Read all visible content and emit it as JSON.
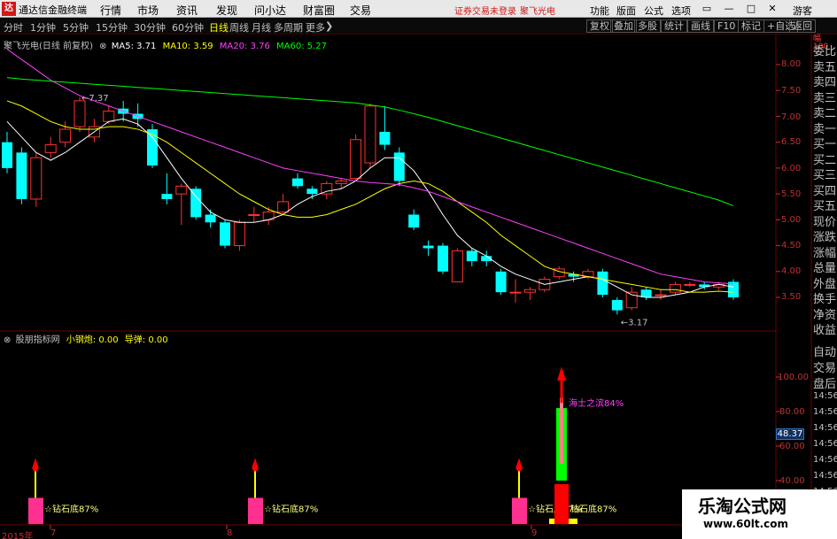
{
  "app": {
    "logo_char": "达",
    "name": "通达信金融终端",
    "menu": [
      "行情",
      "市场",
      "资讯",
      "发现",
      "问小达",
      "财富圈",
      "交易"
    ],
    "status": "证券交易未登录",
    "stock_title": "聚飞光电",
    "right_menu": [
      "功能",
      "版面",
      "公式",
      "选项",
      "游客"
    ],
    "window_controls": [
      "▭",
      "—",
      "□",
      "✕"
    ]
  },
  "toolbar": {
    "periods": [
      "分时",
      "1分钟",
      "5分钟",
      "15分钟",
      "30分钟",
      "60分钟",
      "日线",
      "周线",
      "月线",
      "多周期",
      "更多"
    ],
    "active_period": "日线",
    "more_glyph": "❯",
    "right_buttons": [
      "复权",
      "叠加",
      "多股",
      "统计",
      "画线",
      "F10",
      "标记",
      "+自选",
      "返回"
    ]
  },
  "kline_info": {
    "stock": "聚飞光电(日线 前复权)",
    "ma5": "MA5: 3.71",
    "ma10": "MA10: 3.59",
    "ma20": "MA20: 3.76",
    "ma60": "MA60: 5.27",
    "high_mark": "7.37",
    "low_mark": "3.17"
  },
  "indicator_info": {
    "name": "股朋指标网",
    "v1": "小钢炮: 0.00",
    "v2": "导弹: 0.00",
    "label_diamond": "钻石底87%",
    "label_star": "☆",
    "label_top": "海士之滨84%"
  },
  "right_panel": {
    "top_glyphs": [
      "幅",
      "100"
    ],
    "labels": [
      "委比",
      "卖五",
      "卖四",
      "卖三",
      "卖二",
      "卖一",
      "买一",
      "买二",
      "买三",
      "买四",
      "买五",
      "现价",
      "涨跌",
      "涨幅",
      "总量",
      "外盘",
      "换手",
      "净资",
      "收益"
    ],
    "labels2": [
      "自动",
      "交易",
      "盘后"
    ],
    "times": [
      "14:56",
      "14:56",
      "14:56",
      "14:56",
      "14:56",
      "14:56",
      "14:56",
      "14:56",
      "14:56"
    ]
  },
  "price_axis": [
    "8.00",
    "7.50",
    "7.00",
    "6.50",
    "6.00",
    "5.50",
    "5.00",
    "4.50",
    "4.00",
    "3.50"
  ],
  "ind_axis": [
    "100.00",
    "80.00",
    "60.00",
    "40.00"
  ],
  "ind_current": "48.37",
  "dates": [
    "2015年",
    "7",
    "8",
    "9"
  ],
  "watermark": {
    "title": "乐淘公式网",
    "url": "www.60lt.com"
  },
  "colors": {
    "up": "#ff3030",
    "down": "#00ffff",
    "ma5": "#ffffff",
    "ma10": "#ffff00",
    "ma20": "#ff40ff",
    "ma60": "#00ff00",
    "bar_pink": "#ff3090",
    "bar_yellow": "#ffff00",
    "bar_green": "#00ff00",
    "bar_red": "#ff0000"
  },
  "chart_data": {
    "type": "candlestick",
    "price_range": [
      3.17,
      8.5
    ],
    "candles": [
      {
        "o": 6.5,
        "c": 6.0,
        "h": 6.7,
        "l": 5.9
      },
      {
        "o": 6.3,
        "c": 5.4,
        "h": 6.4,
        "l": 5.3
      },
      {
        "o": 5.4,
        "c": 6.2,
        "h": 6.3,
        "l": 5.25
      },
      {
        "o": 6.3,
        "c": 6.45,
        "h": 6.6,
        "l": 6.2
      },
      {
        "o": 6.5,
        "c": 6.75,
        "h": 6.9,
        "l": 6.4
      },
      {
        "o": 6.8,
        "c": 7.3,
        "h": 7.37,
        "l": 6.7
      },
      {
        "o": 6.6,
        "c": 6.8,
        "h": 6.95,
        "l": 6.5
      },
      {
        "o": 6.9,
        "c": 7.1,
        "h": 7.2,
        "l": 6.85
      },
      {
        "o": 7.15,
        "c": 7.05,
        "h": 7.3,
        "l": 6.9
      },
      {
        "o": 7.05,
        "c": 6.95,
        "h": 7.25,
        "l": 6.8
      },
      {
        "o": 6.75,
        "c": 6.05,
        "h": 6.85,
        "l": 6.0
      },
      {
        "o": 5.5,
        "c": 5.4,
        "h": 5.9,
        "l": 5.3
      },
      {
        "o": 5.5,
        "c": 5.65,
        "h": 5.7,
        "l": 4.9
      },
      {
        "o": 5.6,
        "c": 5.05,
        "h": 5.65,
        "l": 5.0
      },
      {
        "o": 5.1,
        "c": 4.95,
        "h": 5.2,
        "l": 4.85
      },
      {
        "o": 4.95,
        "c": 4.5,
        "h": 5.0,
        "l": 4.45
      },
      {
        "o": 4.5,
        "c": 4.95,
        "h": 5.0,
        "l": 4.4
      },
      {
        "o": 5.1,
        "c": 5.1,
        "h": 5.25,
        "l": 4.95
      },
      {
        "o": 5.0,
        "c": 5.15,
        "h": 5.25,
        "l": 4.9
      },
      {
        "o": 5.15,
        "c": 5.35,
        "h": 5.5,
        "l": 5.1
      },
      {
        "o": 5.8,
        "c": 5.65,
        "h": 5.9,
        "l": 5.6
      },
      {
        "o": 5.6,
        "c": 5.5,
        "h": 5.65,
        "l": 5.4
      },
      {
        "o": 5.5,
        "c": 5.7,
        "h": 5.75,
        "l": 5.4
      },
      {
        "o": 5.7,
        "c": 5.75,
        "h": 5.8,
        "l": 5.6
      },
      {
        "o": 5.8,
        "c": 6.55,
        "h": 6.65,
        "l": 5.75
      },
      {
        "o": 6.1,
        "c": 7.2,
        "h": 7.25,
        "l": 6.0
      },
      {
        "o": 6.7,
        "c": 6.45,
        "h": 7.2,
        "l": 6.35
      },
      {
        "o": 6.3,
        "c": 5.75,
        "h": 6.4,
        "l": 5.65
      },
      {
        "o": 5.1,
        "c": 4.85,
        "h": 5.2,
        "l": 4.8
      },
      {
        "o": 4.5,
        "c": 4.45,
        "h": 4.6,
        "l": 4.3
      },
      {
        "o": 4.5,
        "c": 4.0,
        "h": 4.55,
        "l": 3.95
      },
      {
        "o": 3.8,
        "c": 4.4,
        "h": 4.45,
        "l": 3.8
      },
      {
        "o": 4.4,
        "c": 4.2,
        "h": 4.45,
        "l": 4.1
      },
      {
        "o": 4.3,
        "c": 4.2,
        "h": 4.4,
        "l": 4.1
      },
      {
        "o": 4.0,
        "c": 3.6,
        "h": 4.05,
        "l": 3.55
      },
      {
        "o": 3.6,
        "c": 3.6,
        "h": 3.85,
        "l": 3.4
      },
      {
        "o": 3.6,
        "c": 3.65,
        "h": 3.7,
        "l": 3.45
      },
      {
        "o": 3.65,
        "c": 3.85,
        "h": 3.9,
        "l": 3.6
      },
      {
        "o": 3.9,
        "c": 4.05,
        "h": 4.1,
        "l": 3.85
      },
      {
        "o": 3.95,
        "c": 3.9,
        "h": 4.0,
        "l": 3.8
      },
      {
        "o": 3.9,
        "c": 4.0,
        "h": 4.05,
        "l": 3.85
      },
      {
        "o": 4.0,
        "c": 3.55,
        "h": 4.05,
        "l": 3.5
      },
      {
        "o": 3.45,
        "c": 3.25,
        "h": 3.5,
        "l": 3.17
      },
      {
        "o": 3.3,
        "c": 3.6,
        "h": 3.7,
        "l": 3.25
      },
      {
        "o": 3.65,
        "c": 3.5,
        "h": 3.7,
        "l": 3.45
      },
      {
        "o": 3.55,
        "c": 3.55,
        "h": 3.65,
        "l": 3.45
      },
      {
        "o": 3.6,
        "c": 3.75,
        "h": 3.8,
        "l": 3.55
      },
      {
        "o": 3.75,
        "c": 3.75,
        "h": 3.8,
        "l": 3.7
      },
      {
        "o": 3.75,
        "c": 3.7,
        "h": 3.8,
        "l": 3.65
      },
      {
        "o": 3.7,
        "c": 3.75,
        "h": 3.8,
        "l": 3.65
      },
      {
        "o": 3.8,
        "c": 3.5,
        "h": 3.85,
        "l": 3.45
      }
    ],
    "ma5": [
      6.9,
      6.6,
      6.3,
      6.15,
      6.3,
      6.5,
      6.7,
      6.9,
      6.95,
      6.85,
      6.6,
      6.2,
      5.8,
      5.45,
      5.15,
      5.0,
      4.95,
      4.95,
      5.0,
      5.1,
      5.3,
      5.45,
      5.55,
      5.6,
      5.75,
      6.0,
      6.2,
      6.2,
      5.95,
      5.55,
      5.1,
      4.7,
      4.45,
      4.3,
      4.1,
      3.95,
      3.85,
      3.75,
      3.8,
      3.85,
      3.9,
      3.85,
      3.7,
      3.55,
      3.5,
      3.5,
      3.55,
      3.6,
      3.7,
      3.75,
      3.7
    ],
    "ma10": [
      7.3,
      7.2,
      7.05,
      6.9,
      6.8,
      6.75,
      6.75,
      6.8,
      6.8,
      6.75,
      6.65,
      6.5,
      6.3,
      6.1,
      5.9,
      5.7,
      5.5,
      5.35,
      5.2,
      5.1,
      5.05,
      5.05,
      5.1,
      5.2,
      5.3,
      5.45,
      5.6,
      5.7,
      5.75,
      5.7,
      5.55,
      5.35,
      5.15,
      4.95,
      4.7,
      4.5,
      4.3,
      4.1,
      4.0,
      3.95,
      3.9,
      3.85,
      3.8,
      3.75,
      3.7,
      3.65,
      3.65,
      3.6,
      3.6,
      3.62,
      3.6
    ],
    "ma20": [
      8.3,
      8.1,
      7.9,
      7.7,
      7.55,
      7.4,
      7.3,
      7.2,
      7.1,
      7.0,
      6.9,
      6.8,
      6.7,
      6.6,
      6.5,
      6.4,
      6.3,
      6.2,
      6.1,
      6.0,
      5.95,
      5.9,
      5.85,
      5.8,
      5.75,
      5.72,
      5.7,
      5.68,
      5.62,
      5.55,
      5.45,
      5.35,
      5.25,
      5.15,
      5.05,
      4.95,
      4.85,
      4.75,
      4.65,
      4.55,
      4.45,
      4.35,
      4.25,
      4.15,
      4.05,
      3.95,
      3.9,
      3.85,
      3.8,
      3.78,
      3.76
    ],
    "ma60": [
      7.75,
      7.72,
      7.7,
      7.68,
      7.66,
      7.64,
      7.62,
      7.6,
      7.58,
      7.56,
      7.54,
      7.52,
      7.5,
      7.48,
      7.46,
      7.44,
      7.42,
      7.4,
      7.38,
      7.36,
      7.34,
      7.32,
      7.3,
      7.28,
      7.26,
      7.22,
      7.18,
      7.12,
      7.05,
      6.98,
      6.9,
      6.82,
      6.74,
      6.66,
      6.58,
      6.5,
      6.42,
      6.34,
      6.26,
      6.18,
      6.1,
      6.02,
      5.94,
      5.86,
      5.78,
      5.7,
      5.62,
      5.54,
      5.46,
      5.38,
      5.27
    ],
    "indicator": {
      "range": [
        0,
        100
      ],
      "signals": [
        {
          "candle": 1,
          "bar": 30,
          "stem": 50
        },
        {
          "candle": 17,
          "bar": 30,
          "stem": 50
        },
        {
          "candle": 35,
          "bar": 30,
          "stem": 50
        }
      ],
      "spike": {
        "candle": 38,
        "peak": 100
      }
    }
  }
}
